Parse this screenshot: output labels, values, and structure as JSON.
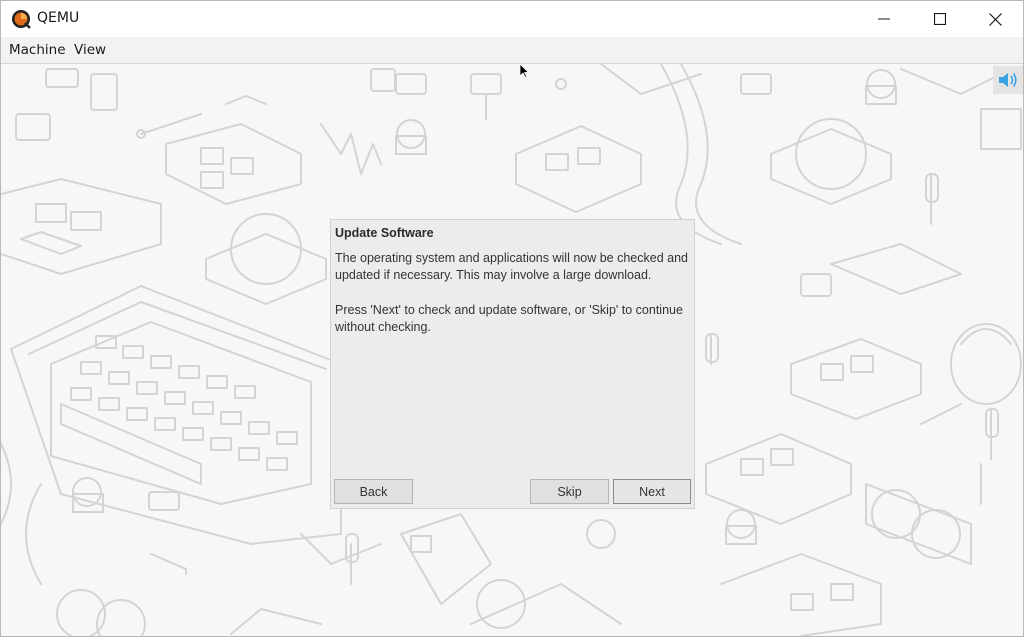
{
  "window": {
    "title": "QEMU"
  },
  "menubar": {
    "items": [
      {
        "label": "Machine"
      },
      {
        "label": "View"
      }
    ]
  },
  "display": {
    "speaker_icon": "speaker-volume-icon"
  },
  "dialog": {
    "title": "Update Software",
    "paragraph1": "The operating system and applications will now be checked and updated if necessary. This may involve a large download.",
    "paragraph2": "Press 'Next' to check and update software, or 'Skip' to continue without checking.",
    "buttons": {
      "back": "Back",
      "skip": "Skip",
      "next": "Next"
    }
  },
  "colors": {
    "wallpaper_line": "#d4d4d4",
    "dialog_bg": "#ececec",
    "speaker_icon": "#3aa3e3"
  }
}
